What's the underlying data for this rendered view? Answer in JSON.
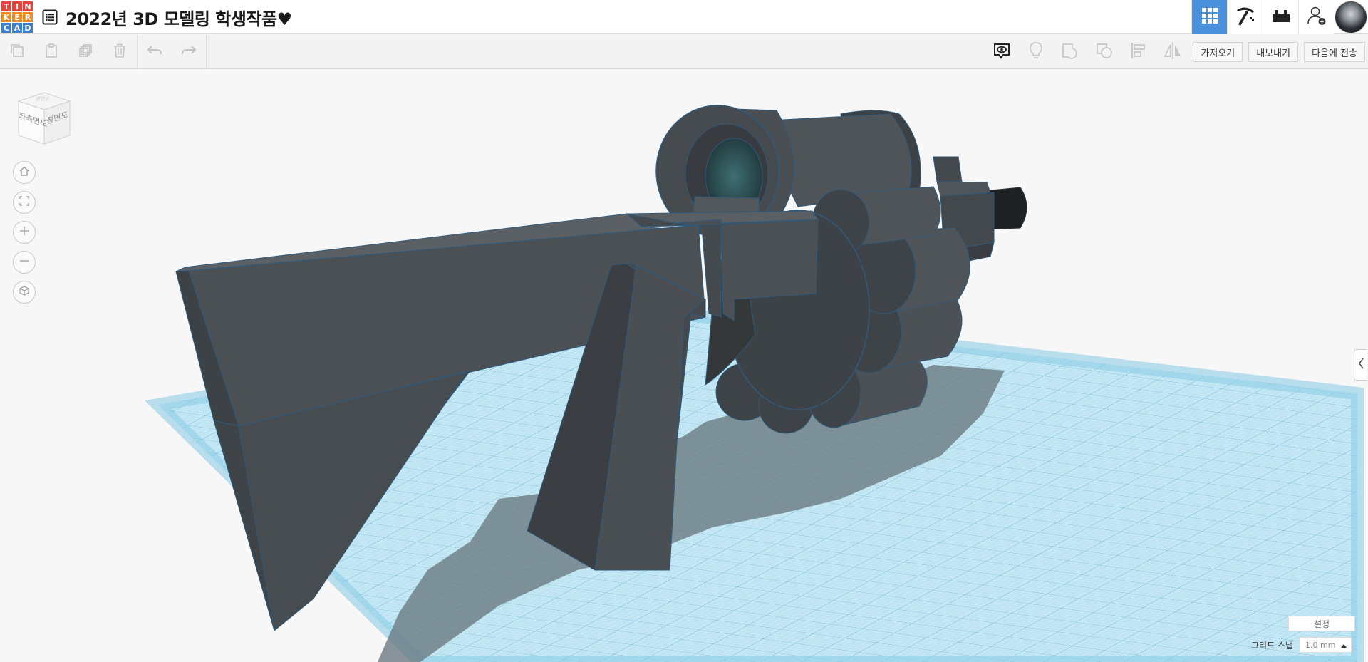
{
  "logo": {
    "letters": [
      "T",
      "I",
      "N",
      "K",
      "E",
      "R",
      "C",
      "A",
      "D"
    ]
  },
  "header": {
    "title": "2022년 3D 모델링 학생작품♥"
  },
  "top_right": {
    "icons": [
      "grid-view-icon",
      "pickaxe-icon",
      "bricks-icon",
      "add-user-icon"
    ]
  },
  "toolbar": {
    "import_label": "가져오기",
    "export_label": "내보내기",
    "send_label": "다음에 전송"
  },
  "viewcube": {
    "left_face": "좌측면도",
    "front_face": "정면도",
    "top_face": "평면도"
  },
  "bottom": {
    "settings_label": "설정",
    "grid_snap_label": "그리드 스냅",
    "grid_snap_value": "1.0 mm"
  },
  "colors": {
    "logo_red": "#e8403a",
    "logo_orange": "#f08a1a",
    "logo_blue": "#3a7fd0",
    "accent_blue": "#4a8fdb",
    "model_gray": "#4a4f55",
    "grid_blue": "#a8dbee"
  }
}
